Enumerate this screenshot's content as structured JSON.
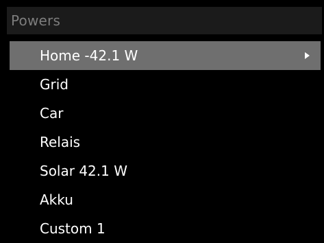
{
  "header": {
    "title": "Powers"
  },
  "menu": {
    "items": [
      {
        "label": "Home -42.1 W",
        "selected": true,
        "icon": "chevron-right-icon"
      },
      {
        "label": "Grid"
      },
      {
        "label": "Car"
      },
      {
        "label": "Relais"
      },
      {
        "label": "Solar 42.1 W"
      },
      {
        "label": "Akku"
      },
      {
        "label": "Custom 1"
      }
    ]
  },
  "colors": {
    "background": "#000000",
    "header_bg": "#1b1b1b",
    "header_text": "#7d7d7d",
    "selected_bg": "#6f6f6f",
    "text": "#ffffff"
  }
}
